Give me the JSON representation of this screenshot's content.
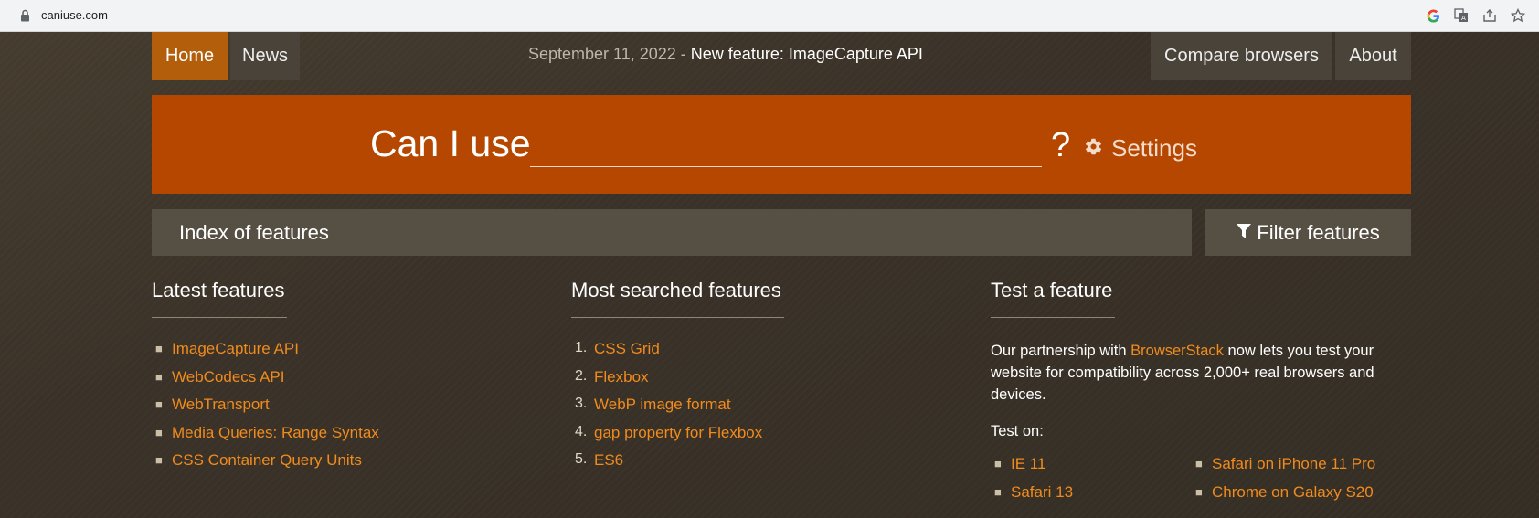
{
  "browser": {
    "url": "caniuse.com",
    "icons": [
      "lock-icon",
      "google-icon",
      "translate-icon",
      "share-icon",
      "star-icon"
    ]
  },
  "nav": {
    "home": "Home",
    "news": "News",
    "compare": "Compare browsers",
    "about": "About",
    "announcement_date": "September 11, 2022 - ",
    "announcement_link": "New feature: ImageCapture API"
  },
  "search": {
    "prefix": "Can I use",
    "value": "",
    "suffix": "?",
    "settings": "Settings"
  },
  "index": {
    "label": "Index of features",
    "filter": "Filter features"
  },
  "latest": {
    "title": "Latest features",
    "items": [
      "ImageCapture API",
      "WebCodecs API",
      "WebTransport",
      "Media Queries: Range Syntax",
      "CSS Container Query Units"
    ]
  },
  "most_searched": {
    "title": "Most searched features",
    "items": [
      "CSS Grid",
      "Flexbox",
      "WebP image format",
      "gap property for Flexbox",
      "ES6"
    ]
  },
  "test": {
    "title": "Test a feature",
    "text_before": "Our partnership with ",
    "link": "BrowserStack",
    "text_after": " now lets you test your website for compatibility across 2,000+ real browsers and devices.",
    "test_on": "Test on:",
    "devices": [
      "IE 11",
      "Safari on iPhone 11 Pro",
      "Safari 13",
      "Chrome on Galaxy S20"
    ]
  },
  "colors": {
    "accent": "#b54700",
    "link": "#f08b1e",
    "home_active": "#b25e0a",
    "background": "#3b3429"
  }
}
